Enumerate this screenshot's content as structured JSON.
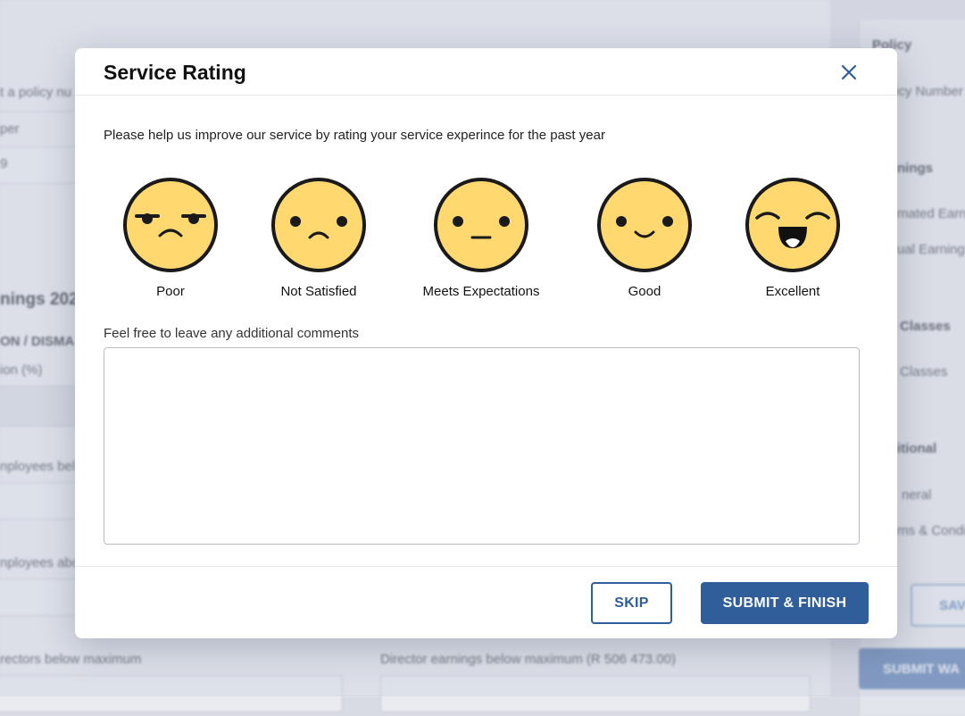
{
  "background": {
    "left_texts": [
      "t a policy nu",
      "per",
      "9",
      "nings 202",
      "ON / DISMA",
      "ion (%)",
      "nployees bel",
      "nployees abo",
      "rectors below maximum"
    ],
    "middle_text": "Director earnings below maximum (R 506 473.00)",
    "right_texts": [
      "Policy",
      "icy Number",
      "nings",
      "mated Earn",
      "ual Earning",
      "Classes",
      "Classes",
      "itional",
      "neral",
      "ms & Condi"
    ],
    "save_button": "SAVE",
    "submit_button": "SUBMIT WA"
  },
  "modal": {
    "title": "Service Rating",
    "close_icon": "close-icon",
    "intro": "Please help us improve our service by rating your service experince for the past year",
    "ratings": [
      {
        "label": "Poor",
        "icon": "poor-face-icon"
      },
      {
        "label": "Not Satisfied",
        "icon": "not-satisfied-face-icon"
      },
      {
        "label": "Meets Expectations",
        "icon": "meets-expectations-face-icon"
      },
      {
        "label": "Good",
        "icon": "good-face-icon"
      },
      {
        "label": "Excellent",
        "icon": "excellent-face-icon"
      }
    ],
    "comments_label": "Feel free to leave any additional comments",
    "comments_value": "",
    "skip_label": "SKIP",
    "submit_label": "SUBMIT & FINISH"
  },
  "colors": {
    "face_fill": "#FFD970",
    "face_stroke": "#1a1a1a",
    "primary": "#2f5e9a"
  }
}
